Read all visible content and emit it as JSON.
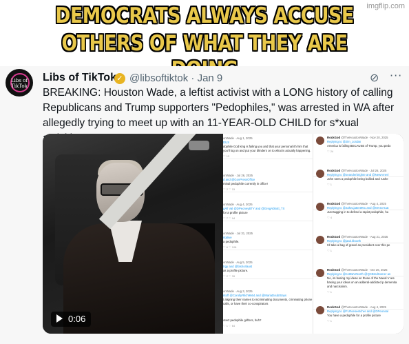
{
  "meme": {
    "caption_line1": "DEMOCRATS ALWAYS ACCUSE",
    "caption_line2": "OTHERS OF WHAT THEY ARE DOING",
    "watermark": "imgflip.com",
    "caption_color": "#e9c84a"
  },
  "tweet": {
    "display_name": "Libs of TikTok",
    "handle_date": "@libsoftiktok · Jan 9",
    "avatar_text": "Libs of TikTok",
    "body": "BREAKING: Houston Wade, a leftist activist with a LONG history of calling Republicans and Trump supporters \"Pedophiles,\" was arrested in WA after allegedly trying to meet up with an 11-YEAR-OLD CHILD for s*xual activities.",
    "verified_badge_color": "#e8b422",
    "video_duration": "0:06"
  },
  "screenshot_posts_left": [
    {
      "header": "onWade · Aug 1, 2025",
      "mention": "DUS",
      "text": "dophile God king is failing you and that your personal ith him that you'll log on and put your blinders on to what is actually happening.",
      "acts": "♡ 13"
    },
    {
      "header": "onWade · Jul 26, 2025",
      "mention": "d and @GovPressOffice",
      "text": "minal pedophile currently in office!",
      "acts": "♡ 2   ♡ 15"
    },
    {
      "header": "onWade · Aug 4, 2025",
      "mention": "gAll Val @DPeoneyBTY and @GregAbbott_TX",
      "text": "for a profile picture",
      "acts": "♡ 7   ♡ 94"
    },
    {
      "header": "onWade · Jul 31, 2025",
      "mention": "ntative",
      "text": "a pedophile.",
      "acts": "♡ 6   ♡ 108"
    },
    {
      "header": "onWade · Aug 5, 2025",
      "mention": "trgy and @fashorlaust",
      "text": "as a profile picture.",
      "acts": "♡ 2   ♡ 39"
    },
    {
      "header": "onWade · Aug 3, 2025",
      "mention": "ntoff @CorollyRilch9664 and @MariaDoubtSays",
      "text": "t aligning their names to incriminating documents, criminating phone calls, or have their co-conspirators",
      "acts": ""
    },
    {
      "header": "",
      "mention": "",
      "text": "otect pedophile grifters, huh?",
      "acts": "♡ 1   ♡ 64"
    }
  ],
  "screenshot_posts_right": [
    {
      "name": "RockGod",
      "header": "@TheHoustonWade · Nov 20, 2025",
      "reply": "Replying to @Jim_Jordan",
      "text": "America is failing BECAUSE of Trump, you pedo",
      "acts": "♡ 24"
    },
    {
      "name": "RockGod",
      "header": "@TheHoustonWade · Jul 26, 2025",
      "reply": "Replying to @seanderbrighte and @NewAmeri",
      "text": "John sees a pedophile being bullied and rushe",
      "acts": "♡ 1"
    },
    {
      "name": "RockGod",
      "header": "@TheHoustonWade · Aug 4, 2025",
      "reply": "Replying to @JakeLjatte4901 and @MAGACat",
      "text": "Just tagging in to defend a rapist pedophile, hu",
      "acts": "♡ 4"
    },
    {
      "name": "RockGod",
      "header": "@TheHoustonWade · Aug 21, 2025",
      "reply": "Replying to @jaak.kbooth",
      "text": "I'd take a bag of gravel as president over this pe",
      "acts": "♡ 1"
    },
    {
      "name": "RockGod",
      "header": "@TheHoustonWade · Oct 26, 2025",
      "reply": "Replying to @nxtDaVrNorth @QCBmdSomer an",
      "text": "No, im basing my ideas on those of the Naval V are basing your ideas on an adderal-addicted p dementia and narcissism.",
      "acts": "♡ 1"
    },
    {
      "name": "RockGod",
      "header": "@TheHoustonWade · Aug 4, 2025",
      "reply": "Replying to @FLRoeseetcher and @DPeonsal",
      "text": "You have a pedophile for a profile picture",
      "acts": "♡ 1"
    }
  ]
}
